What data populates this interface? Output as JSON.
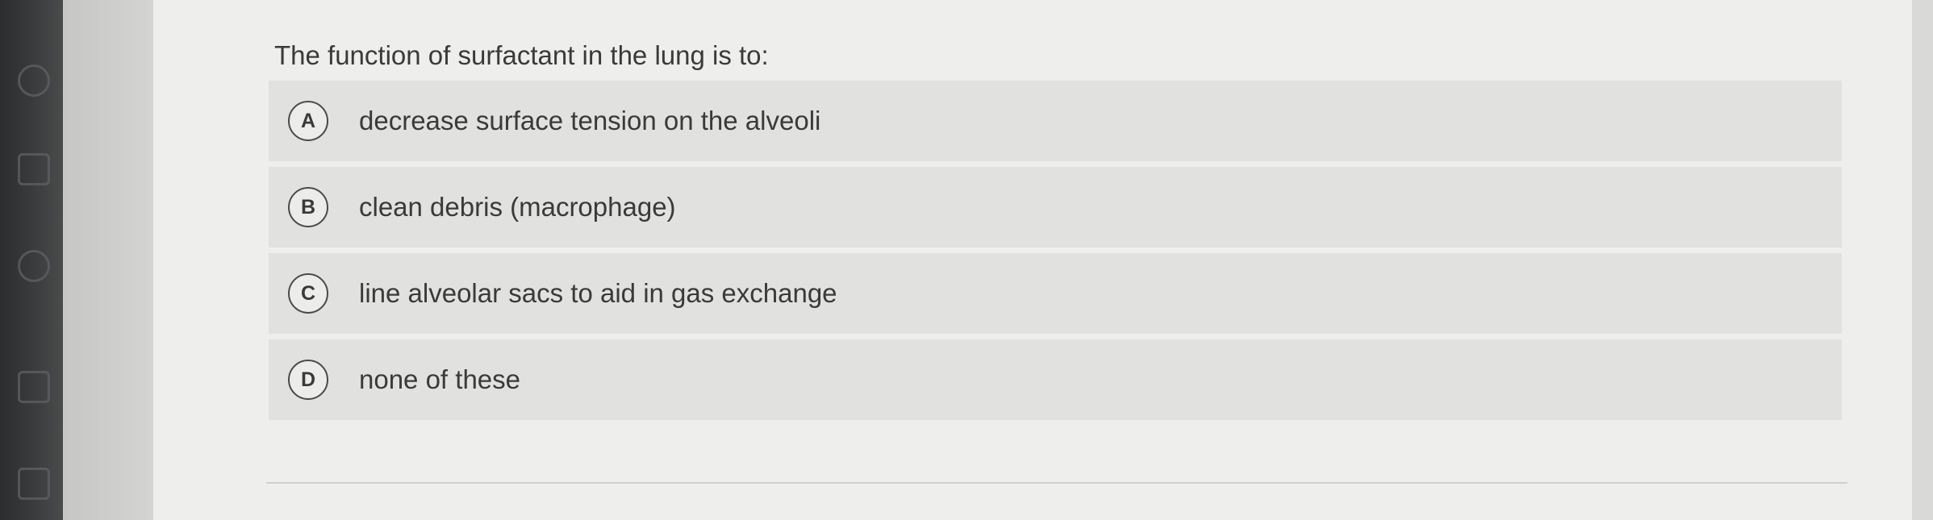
{
  "question": {
    "text": "The function of surfactant in the lung is to:"
  },
  "options": [
    {
      "letter": "A",
      "text": "decrease surface tension on the alveoli"
    },
    {
      "letter": "B",
      "text": "clean debris (macrophage)"
    },
    {
      "letter": "C",
      "text": "line alveolar sacs to aid in gas exchange"
    },
    {
      "letter": "D",
      "text": "none of these"
    }
  ],
  "sidebar": {
    "icons": [
      "globe-icon",
      "calendar-icon",
      "people-icon",
      "calculator-icon",
      "mail-icon"
    ]
  }
}
